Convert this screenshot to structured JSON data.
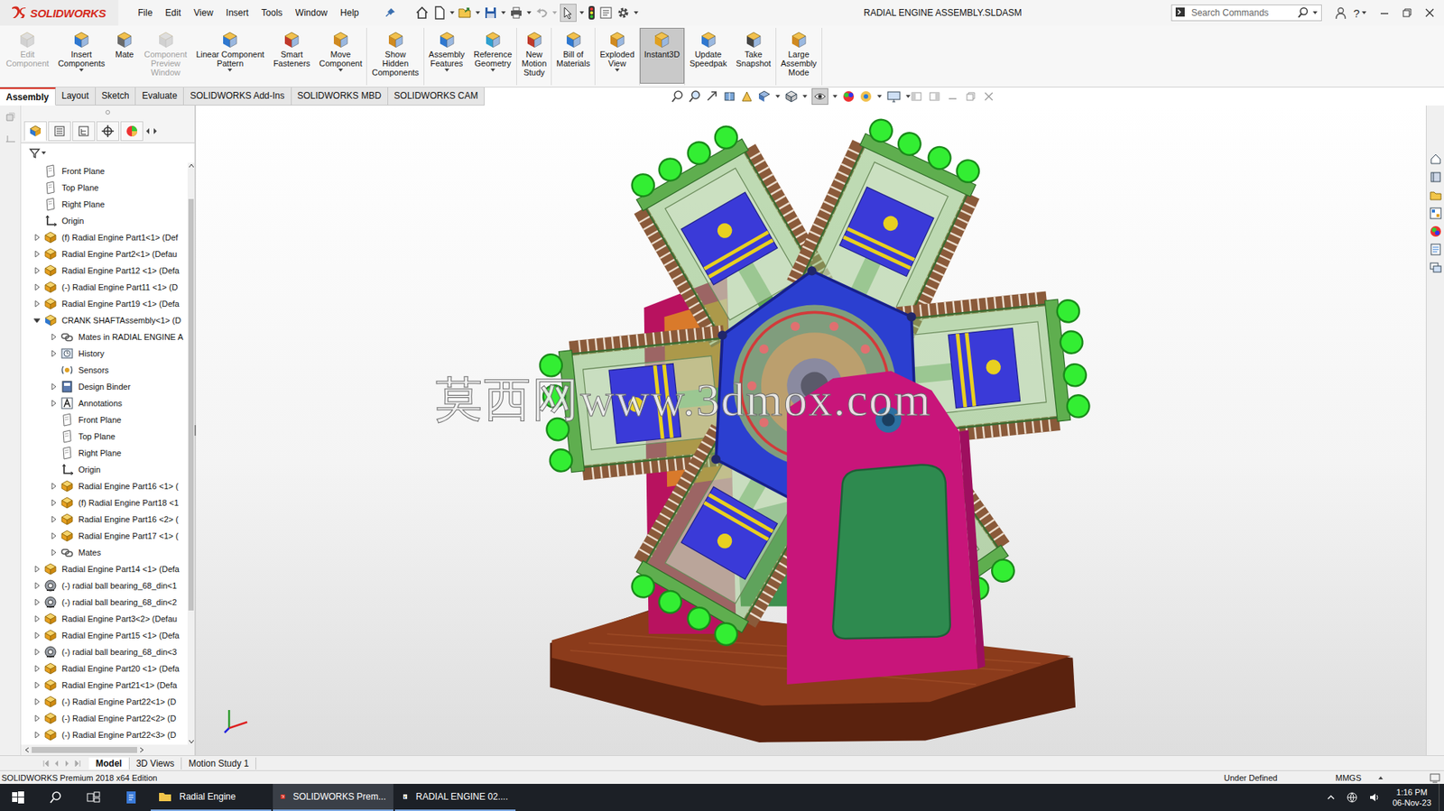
{
  "app": {
    "name": "SOLIDWORKS",
    "title": "RADIAL ENGINE ASSEMBLY.SLDASM",
    "help": "?"
  },
  "menu": [
    "File",
    "Edit",
    "View",
    "Insert",
    "Tools",
    "Window",
    "Help"
  ],
  "search": {
    "placeholder": "Search Commands"
  },
  "ribbon": [
    [
      {
        "lines": [
          "Edit",
          "Component"
        ],
        "icon": "edit",
        "disabled": true,
        "dropdown": false,
        "selected": false
      },
      {
        "lines": [
          "Insert",
          "Components"
        ],
        "icon": "insert",
        "disabled": false,
        "dropdown": true,
        "selected": false
      },
      {
        "lines": [
          "Mate"
        ],
        "icon": "mate",
        "disabled": false,
        "dropdown": false,
        "selected": false
      },
      {
        "lines": [
          "Component",
          "Preview",
          "Window"
        ],
        "icon": "preview",
        "disabled": true,
        "dropdown": false,
        "selected": false
      },
      {
        "lines": [
          "Linear Component",
          "Pattern"
        ],
        "icon": "pattern",
        "disabled": false,
        "dropdown": true,
        "selected": false
      },
      {
        "lines": [
          "Smart",
          "Fasteners"
        ],
        "icon": "fasteners",
        "disabled": false,
        "dropdown": false,
        "selected": false
      },
      {
        "lines": [
          "Move",
          "Component"
        ],
        "icon": "move",
        "disabled": false,
        "dropdown": true,
        "selected": false
      }
    ],
    [
      {
        "lines": [
          "Show",
          "Hidden",
          "Components"
        ],
        "icon": "show",
        "disabled": false,
        "dropdown": false,
        "selected": false
      }
    ],
    [
      {
        "lines": [
          "Assembly",
          "Features"
        ],
        "icon": "features",
        "disabled": false,
        "dropdown": true,
        "selected": false
      },
      {
        "lines": [
          "Reference",
          "Geometry"
        ],
        "icon": "refgeom",
        "disabled": false,
        "dropdown": true,
        "selected": false
      }
    ],
    [
      {
        "lines": [
          "New",
          "Motion",
          "Study"
        ],
        "icon": "motion",
        "disabled": false,
        "dropdown": false,
        "selected": false
      }
    ],
    [
      {
        "lines": [
          "Bill of",
          "Materials"
        ],
        "icon": "bom",
        "disabled": false,
        "dropdown": false,
        "selected": false
      }
    ],
    [
      {
        "lines": [
          "Exploded",
          "View"
        ],
        "icon": "exploded",
        "disabled": false,
        "dropdown": true,
        "selected": false
      }
    ],
    [
      {
        "lines": [
          "Instant3D"
        ],
        "icon": "instant3d",
        "disabled": false,
        "dropdown": false,
        "selected": true
      }
    ],
    [
      {
        "lines": [
          "Update",
          "Speedpak"
        ],
        "icon": "speedpak",
        "disabled": false,
        "dropdown": false,
        "selected": false
      },
      {
        "lines": [
          "Take",
          "Snapshot"
        ],
        "icon": "snapshot",
        "disabled": false,
        "dropdown": false,
        "selected": false
      }
    ],
    [
      {
        "lines": [
          "Large",
          "Assembly",
          "Mode"
        ],
        "icon": "large",
        "disabled": false,
        "dropdown": false,
        "selected": false
      }
    ]
  ],
  "tabs": [
    {
      "label": "Assembly",
      "selected": true
    },
    {
      "label": "Layout",
      "selected": false
    },
    {
      "label": "Sketch",
      "selected": false
    },
    {
      "label": "Evaluate",
      "selected": false
    },
    {
      "label": "SOLIDWORKS Add-Ins",
      "selected": false
    },
    {
      "label": "SOLIDWORKS MBD",
      "selected": false
    },
    {
      "label": "SOLIDWORKS CAM",
      "selected": false
    }
  ],
  "tree": [
    {
      "label": "Front Plane",
      "level": 0,
      "kind": "plane",
      "expandable": false,
      "expanded": false
    },
    {
      "label": "Top Plane",
      "level": 0,
      "kind": "plane",
      "expandable": false,
      "expanded": false
    },
    {
      "label": "Right Plane",
      "level": 0,
      "kind": "plane",
      "expandable": false,
      "expanded": false
    },
    {
      "label": "Origin",
      "level": 0,
      "kind": "origin",
      "expandable": false,
      "expanded": false
    },
    {
      "label": "(f) Radial Engine Part1<1> (Def",
      "level": 0,
      "kind": "part",
      "expandable": true,
      "expanded": false
    },
    {
      "label": "Radial Engine Part2<1> (Defau",
      "level": 0,
      "kind": "part",
      "expandable": true,
      "expanded": false
    },
    {
      "label": "Radial Engine Part12 <1> (Defa",
      "level": 0,
      "kind": "part",
      "expandable": true,
      "expanded": false
    },
    {
      "label": "(-) Radial Engine Part11 <1> (D",
      "level": 0,
      "kind": "part",
      "expandable": true,
      "expanded": false
    },
    {
      "label": "Radial Engine Part19 <1> (Defa",
      "level": 0,
      "kind": "part",
      "expandable": true,
      "expanded": false
    },
    {
      "label": "CRANK SHAFTAssembly<1> (D",
      "level": 0,
      "kind": "assembly",
      "expandable": true,
      "expanded": true
    },
    {
      "label": "Mates in RADIAL ENGINE A",
      "level": 1,
      "kind": "mates",
      "expandable": true,
      "expanded": false
    },
    {
      "label": "History",
      "level": 1,
      "kind": "history",
      "expandable": true,
      "expanded": false
    },
    {
      "label": "Sensors",
      "level": 1,
      "kind": "sensors",
      "expandable": false,
      "expanded": false
    },
    {
      "label": "Design Binder",
      "level": 1,
      "kind": "binder",
      "expandable": true,
      "expanded": false
    },
    {
      "label": "Annotations",
      "level": 1,
      "kind": "annotations",
      "expandable": true,
      "expanded": false
    },
    {
      "label": "Front Plane",
      "level": 1,
      "kind": "plane",
      "expandable": false,
      "expanded": false
    },
    {
      "label": "Top Plane",
      "level": 1,
      "kind": "plane",
      "expandable": false,
      "expanded": false
    },
    {
      "label": "Right Plane",
      "level": 1,
      "kind": "plane",
      "expandable": false,
      "expanded": false
    },
    {
      "label": "Origin",
      "level": 1,
      "kind": "origin",
      "expandable": false,
      "expanded": false
    },
    {
      "label": "Radial Engine Part16 <1> (",
      "level": 1,
      "kind": "part",
      "expandable": true,
      "expanded": false
    },
    {
      "label": "(f) Radial Engine Part18 <1",
      "level": 1,
      "kind": "part",
      "expandable": true,
      "expanded": false
    },
    {
      "label": "Radial Engine Part16 <2> (",
      "level": 1,
      "kind": "part",
      "expandable": true,
      "expanded": false
    },
    {
      "label": "Radial Engine Part17 <1> (",
      "level": 1,
      "kind": "part",
      "expandable": true,
      "expanded": false
    },
    {
      "label": "Mates",
      "level": 1,
      "kind": "mates",
      "expandable": true,
      "expanded": false
    },
    {
      "label": "Radial Engine Part14 <1> (Defa",
      "level": 0,
      "kind": "part",
      "expandable": true,
      "expanded": false
    },
    {
      "label": "(-) radial ball bearing_68_din<1",
      "level": 0,
      "kind": "bearing",
      "expandable": true,
      "expanded": false
    },
    {
      "label": "(-) radial ball bearing_68_din<2",
      "level": 0,
      "kind": "bearing",
      "expandable": true,
      "expanded": false
    },
    {
      "label": "Radial Engine Part3<2> (Defau",
      "level": 0,
      "kind": "part",
      "expandable": true,
      "expanded": false
    },
    {
      "label": "Radial Engine Part15 <1> (Defa",
      "level": 0,
      "kind": "part",
      "expandable": true,
      "expanded": false
    },
    {
      "label": "(-) radial ball bearing_68_din<3",
      "level": 0,
      "kind": "bearing",
      "expandable": true,
      "expanded": false
    },
    {
      "label": "Radial Engine Part20 <1> (Defa",
      "level": 0,
      "kind": "part",
      "expandable": true,
      "expanded": false
    },
    {
      "label": "Radial Engine Part21<1> (Defa",
      "level": 0,
      "kind": "part",
      "expandable": true,
      "expanded": false
    },
    {
      "label": "(-) Radial Engine Part22<1> (D",
      "level": 0,
      "kind": "part",
      "expandable": true,
      "expanded": false
    },
    {
      "label": "(-) Radial Engine Part22<2> (D",
      "level": 0,
      "kind": "part",
      "expandable": true,
      "expanded": false
    },
    {
      "label": "(-) Radial Engine Part22<3> (D",
      "level": 0,
      "kind": "part",
      "expandable": true,
      "expanded": false
    }
  ],
  "viewport": {
    "watermark": "莫西网www.3dmox.com"
  },
  "bottom_tabs": [
    {
      "label": "Model",
      "selected": true
    },
    {
      "label": "3D Views",
      "selected": false
    },
    {
      "label": "Motion Study 1",
      "selected": false
    }
  ],
  "status_bar": {
    "edition": "SOLIDWORKS Premium 2018 x64 Edition",
    "state": "Under Defined",
    "units": "MMGS"
  },
  "taskbar": {
    "items": [
      {
        "label": "Radial Engine",
        "icon": "folder",
        "selected": false
      },
      {
        "label": "SOLIDWORKS Prem...",
        "icon": "solidworks",
        "selected": true
      },
      {
        "label": "RADIAL ENGINE 02....",
        "icon": "document",
        "selected": false
      }
    ],
    "time": "1:16 PM",
    "date": "06-Nov-23"
  }
}
